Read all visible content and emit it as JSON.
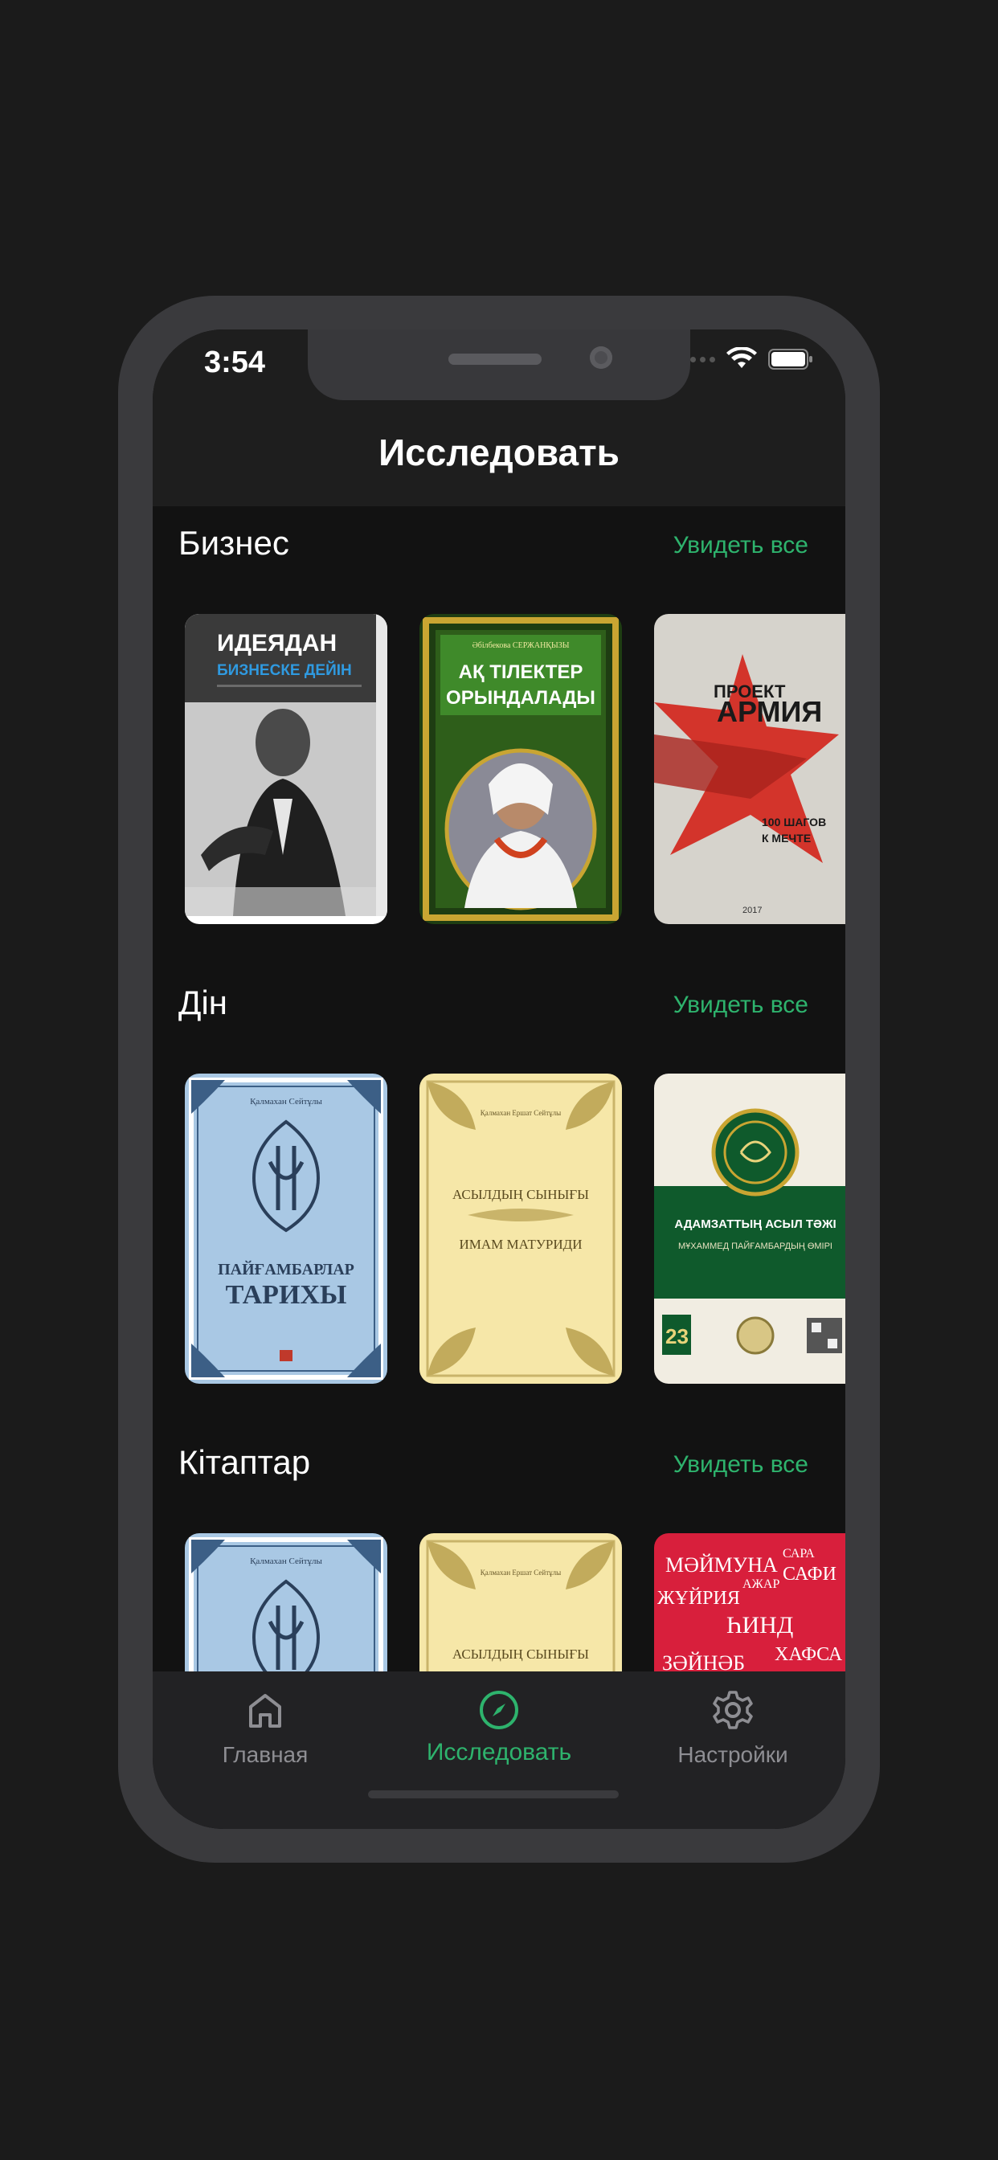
{
  "status": {
    "time": "3:54"
  },
  "header": {
    "title": "Исследовать"
  },
  "sections": [
    {
      "title": "Бизнес",
      "see_all": "Увидеть все",
      "books": [
        {
          "cover_title": "ИДЕЯДАН",
          "cover_subtitle": "БИЗНЕСКЕ ДЕЙІН"
        },
        {
          "cover_top": "Әбілбекова СЕРЖАНҚЫЗЫ",
          "cover_title_1": "АҚ ТІЛЕКТЕР",
          "cover_title_2": "ОРЫНДАЛАДЫ"
        },
        {
          "cover_title_1": "ПРОЕКТ",
          "cover_title_2": "АРМИЯ",
          "cover_subtitle_1": "100 ШАГОВ",
          "cover_subtitle_2": "К МЕЧТЕ",
          "cover_year": "2017"
        }
      ]
    },
    {
      "title": "Дін",
      "see_all": "Увидеть все",
      "books": [
        {
          "cover_author": "Қалмахан Сейтұлы",
          "cover_title_1": "ПАЙҒАМБАРЛАР",
          "cover_title_2": "ТАРИХЫ"
        },
        {
          "cover_author": "Қалмахан Ершат Сейтұлы",
          "cover_title_1": "АСЫЛДЫҢ СЫНЫҒЫ",
          "cover_title_2": "ИМАМ МАТУРИДИ"
        },
        {
          "cover_title": "АДАМЗАТТЫҢ АСЫЛ ТӘЖІ",
          "cover_subtitle": "МҰХАММЕД ПАЙҒАМБАРДЫҢ ӨМІРІ",
          "cover_badge": "23"
        }
      ]
    },
    {
      "title": "Кітаптар",
      "see_all": "Увидеть все",
      "books": [
        {
          "cover_author": "Қалмахан Сейтұлы"
        },
        {
          "cover_author": "Қалмахан Ершат Сейтұлы",
          "cover_title_1": "АСЫЛДЫҢ СЫНЫҒЫ"
        },
        {
          "cover_words": [
            "МӘЙМУНА",
            "САФИ",
            "ЖҰЙРИЯ",
            "ҺИНД",
            "ЗӘЙНӘБ",
            "ХАФСА",
            "САРА",
            "АЖАР"
          ]
        }
      ]
    }
  ],
  "tabs": [
    {
      "label": "Главная",
      "icon": "home-icon"
    },
    {
      "label": "Исследовать",
      "icon": "compass-icon"
    },
    {
      "label": "Настройки",
      "icon": "gear-icon"
    }
  ],
  "colors": {
    "accent": "#2eb36d",
    "inactive": "#8e8e93",
    "background": "#121212"
  }
}
